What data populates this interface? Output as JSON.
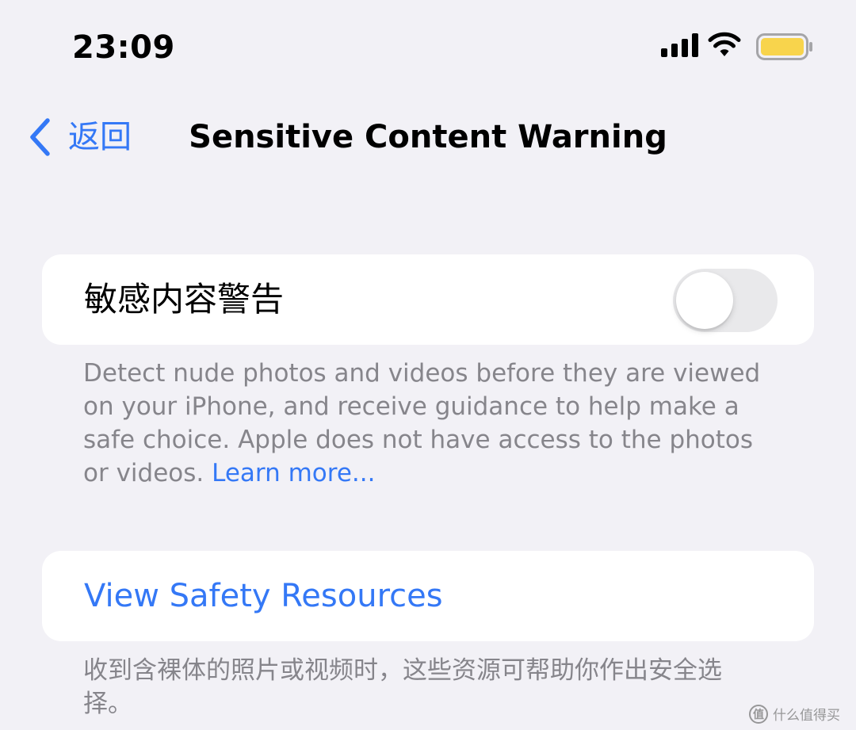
{
  "status_bar": {
    "time": "23:09",
    "icons": [
      "signal-icon",
      "wifi-icon",
      "battery-icon"
    ],
    "battery_color": "#f8d44c"
  },
  "nav": {
    "back_label": "返回",
    "title": "Sensitive Content Warning"
  },
  "toggle_section": {
    "label": "敏感内容警告",
    "toggle_on": false,
    "footer_text": "Detect nude photos and videos before they are viewed on your iPhone, and receive guidance to help make a safe choice. Apple does not have access to the photos or videos. ",
    "footer_link": "Learn more..."
  },
  "resources_section": {
    "link_label": "View Safety Resources",
    "footer_text": "收到含裸体的照片或视频时，这些资源可帮助你作出安全选择。"
  },
  "watermark": {
    "logo_char": "值",
    "text": "什么值得买"
  },
  "colors": {
    "accent": "#3478f6",
    "background": "#f2f1f6",
    "secondary_text": "#86858b"
  }
}
